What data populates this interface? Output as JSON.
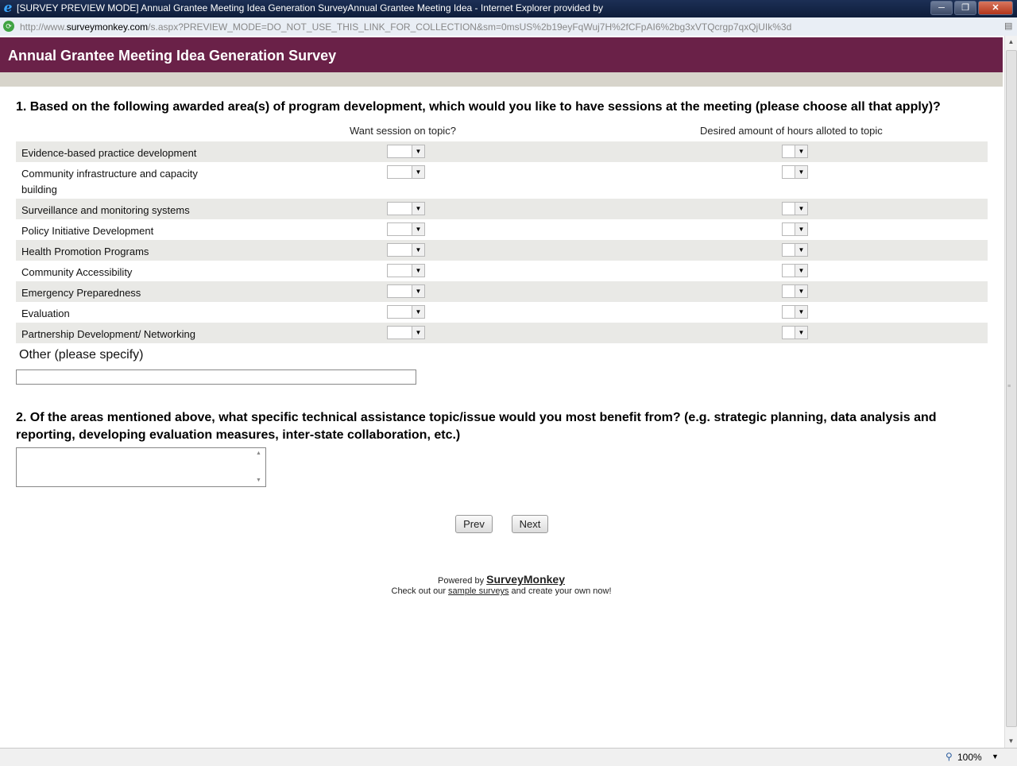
{
  "window": {
    "title": "[SURVEY PREVIEW MODE] Annual Grantee Meeting Idea Generation SurveyAnnual Grantee Meeting Idea  - Internet Explorer provided by",
    "url_prefix": "http://www.",
    "url_domain": "surveymonkey.com",
    "url_rest": "/s.aspx?PREVIEW_MODE=DO_NOT_USE_THIS_LINK_FOR_COLLECTION&sm=0msUS%2b19eyFqWuj7H%2fCFpAI6%2bg3xVTQcrgp7qxQjUIk%3d"
  },
  "survey": {
    "title": "Annual Grantee Meeting Idea Generation Survey",
    "q1": {
      "text": "1. Based on the following awarded area(s) of program development, which would you like to have sessions at the meeting (please choose all that apply)?",
      "col1": "Want session on topic?",
      "col2": "Desired amount of hours alloted to topic",
      "rows": [
        {
          "label": "Evidence-based practice development"
        },
        {
          "label": "Community infrastructure and capacity building"
        },
        {
          "label": "Surveillance and monitoring systems"
        },
        {
          "label": "Policy Initiative Development"
        },
        {
          "label": "Health Promotion Programs"
        },
        {
          "label": "Community Accessibility"
        },
        {
          "label": "Emergency Preparedness"
        },
        {
          "label": "Evaluation"
        },
        {
          "label": "Partnership Development/ Networking"
        }
      ],
      "other_label": "Other (please specify)",
      "other_value": ""
    },
    "q2": {
      "text": "2. Of the areas mentioned above, what specific technical assistance topic/issue would you most benefit from? (e.g. strategic planning, data analysis and reporting, developing evaluation measures, inter-state collaboration, etc.)",
      "value": ""
    },
    "nav": {
      "prev": "Prev",
      "next": "Next"
    },
    "footer": {
      "powered_by": "Powered by",
      "brand": "SurveyMonkey",
      "check_out": "Check out our",
      "sample_link": "sample surveys",
      "create": "and create your own now!"
    }
  },
  "statusbar": {
    "zoom": "100%"
  },
  "icons": {
    "ie": "internet-explorer-icon",
    "address": "page-icon",
    "zoom": "magnifier-icon"
  }
}
